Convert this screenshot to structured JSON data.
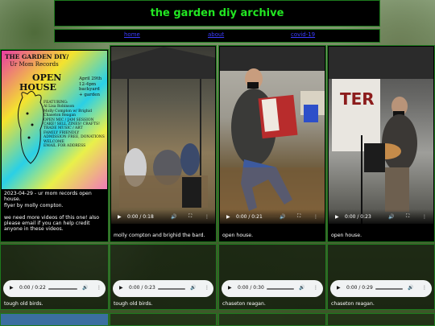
{
  "site": {
    "title": "the garden diy archive"
  },
  "nav": [
    {
      "label": "home"
    },
    {
      "label": "about"
    },
    {
      "label": "covid-19"
    }
  ],
  "poster": {
    "line1": "THE GARDEN DIY/",
    "line2": "Ur Mom Records",
    "line3": "OPEN",
    "line4": "HOUSE",
    "date": "April 29th\n12-4pm\nbackyard\n+ garden",
    "body": "FEATURING:\nAl Lisa Robinson\nMolly Compton w/ Brighid\nChaseton Reagan\nOPEN MIC / JAM SESSION\nCAKE! SELL ZINES! CRAFTS!\nTRADE MUSIC / ART\nFAMILY FRIENDLY\nADMISSION FREE, DONATIONS\nWELCOME\nEMAIL FOR ADDRESS"
  },
  "cards": [
    {
      "kind": "poster",
      "caption": "2023-04-29 - ur mom records open house.\nflyer by molly compton.\n\nwe need more videos of this one! also please email if you can help credit anyone in these videos."
    },
    {
      "kind": "video",
      "time": "0:00 / 0:18",
      "caption": "molly compton and brighid the bard."
    },
    {
      "kind": "video",
      "time": "0:00 / 0:21",
      "caption": "open house."
    },
    {
      "kind": "video",
      "time": "0:00 / 0:23",
      "caption": "open house."
    },
    {
      "kind": "audio",
      "time": "0:00 / 0:22",
      "caption": "tough old birds."
    },
    {
      "kind": "audio",
      "time": "0:00 / 0:23",
      "caption": "tough old birds."
    },
    {
      "kind": "audio",
      "time": "0:00 / 0:30",
      "caption": "chaseton reagan."
    },
    {
      "kind": "audio",
      "time": "0:00 / 0:29",
      "caption": "chaseton reagan."
    }
  ],
  "poster_sign": "TER",
  "icons": {
    "play": "play-icon",
    "volume": "volume-icon",
    "fullscreen": "fullscreen-icon",
    "more": "more-icon"
  },
  "colors": {
    "accent": "#22e622",
    "border": "#1d7a1d",
    "link": "#3b3bff"
  }
}
